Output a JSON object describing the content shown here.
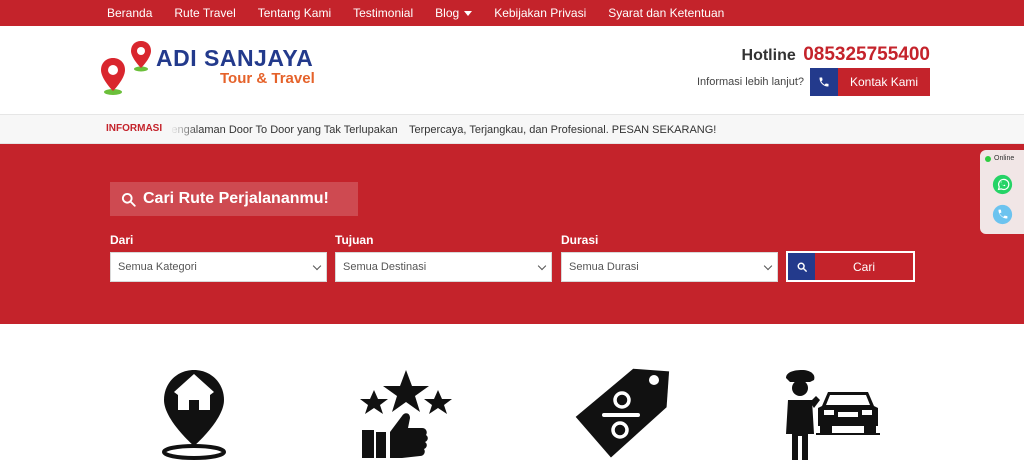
{
  "topnav": {
    "items": [
      {
        "label": "Beranda"
      },
      {
        "label": "Rute Travel"
      },
      {
        "label": "Tentang Kami"
      },
      {
        "label": "Testimonial"
      },
      {
        "label": "Blog",
        "has_dropdown": true
      },
      {
        "label": "Kebijakan Privasi"
      },
      {
        "label": "Syarat dan Ketentuan"
      }
    ]
  },
  "brand": {
    "name": "ADI SANJAYA",
    "tagline": "Tour & Travel"
  },
  "header": {
    "hotline_label": "Hotline",
    "hotline_number": "085325755400",
    "info_text": "Informasi lebih lanjut?",
    "contact_button": "Kontak Kami"
  },
  "ticker": {
    "label": "INFORMASI",
    "messages": [
      "Pengalaman Door To Door yang Tak Terlupakan",
      "Terpercaya, Terjangkau, dan Profesional. PESAN SEKARANG!"
    ]
  },
  "search": {
    "title": "Cari Rute Perjalananmu!",
    "fields": [
      {
        "label": "Dari",
        "value": "Semua Kategori"
      },
      {
        "label": "Tujuan",
        "value": "Semua Destinasi"
      },
      {
        "label": "Durasi",
        "value": "Semua Durasi"
      }
    ],
    "button": "Cari"
  },
  "side_widget": {
    "status": "Online"
  },
  "colors": {
    "primary_red": "#c4232b",
    "navy": "#233a8c",
    "orange": "#e5622a",
    "whatsapp_green": "#25d366"
  },
  "features": {
    "icons": [
      "home-location-icon",
      "rating-stars-icon",
      "discount-tag-icon",
      "driver-car-icon"
    ]
  }
}
